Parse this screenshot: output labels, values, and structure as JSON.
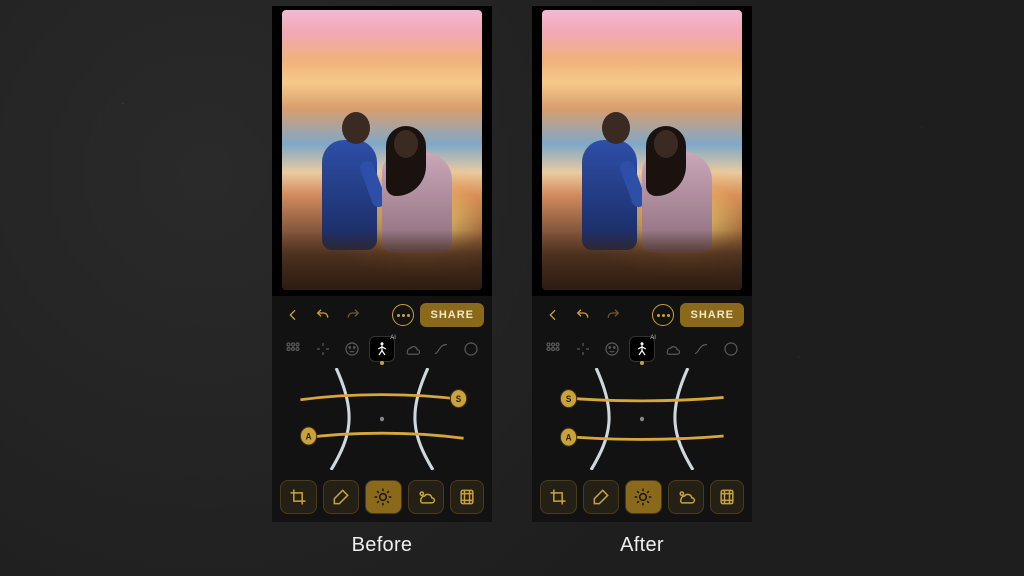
{
  "comparison": {
    "before_label": "Before",
    "after_label": "After"
  },
  "app": {
    "share_label": "SHARE",
    "topbar_icons": [
      "back",
      "undo",
      "redo",
      "more"
    ],
    "toolrow": [
      {
        "name": "autofix",
        "selected": false
      },
      {
        "name": "sparkle",
        "selected": false
      },
      {
        "name": "face",
        "selected": false
      },
      {
        "name": "body-ai",
        "selected": true,
        "ai_badge": "AI"
      },
      {
        "name": "sky",
        "selected": false
      },
      {
        "name": "curve",
        "selected": false
      },
      {
        "name": "vignette",
        "selected": false
      }
    ],
    "bottombar": [
      {
        "name": "crop",
        "selected": false
      },
      {
        "name": "erase",
        "selected": false
      },
      {
        "name": "light",
        "selected": true
      },
      {
        "name": "color",
        "selected": false
      },
      {
        "name": "film",
        "selected": false
      }
    ],
    "curve_knobs": {
      "before": {
        "s": {
          "side": "right"
        },
        "a": {
          "side": "left"
        }
      },
      "after": {
        "s": {
          "side": "left"
        },
        "a": {
          "side": "left"
        }
      },
      "s_label": "S",
      "a_label": "A"
    }
  }
}
